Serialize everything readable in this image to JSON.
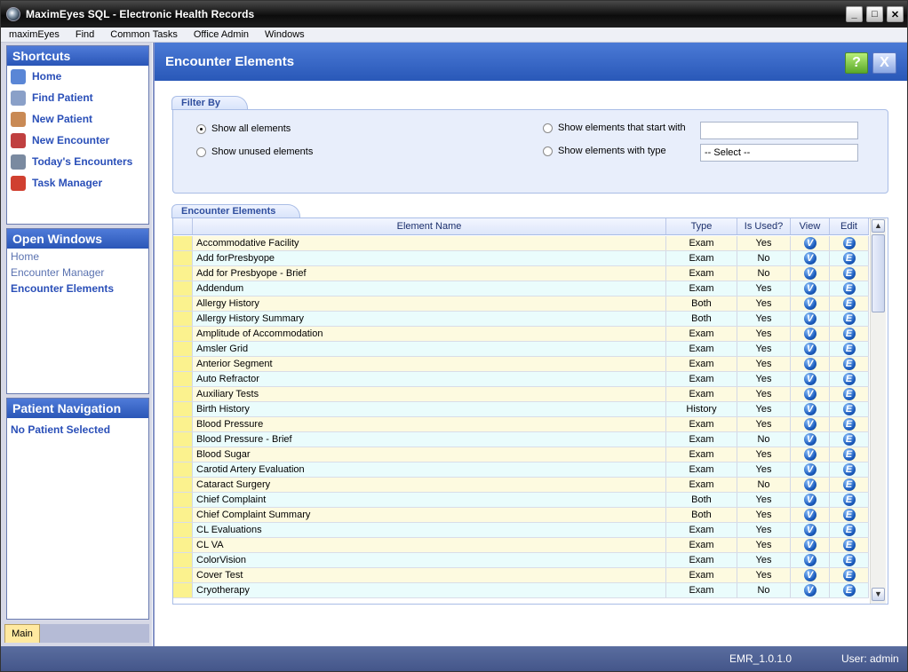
{
  "window": {
    "title": "MaximEyes SQL - Electronic Health Records",
    "min": "_",
    "max": "□",
    "close": "✕"
  },
  "menu": [
    "maximEyes",
    "Find",
    "Common Tasks",
    "Office Admin",
    "Windows"
  ],
  "sidebar": {
    "shortcuts_title": "Shortcuts",
    "shortcuts": [
      {
        "label": "Home",
        "icon": "home-icon",
        "color": "#5a86d6"
      },
      {
        "label": "Find Patient",
        "icon": "find-patient-icon",
        "color": "#8aa0c8"
      },
      {
        "label": "New Patient",
        "icon": "new-patient-icon",
        "color": "#c98a55"
      },
      {
        "label": "New Encounter",
        "icon": "new-encounter-icon",
        "color": "#c04040"
      },
      {
        "label": "Today's Encounters",
        "icon": "todays-encounters-icon",
        "color": "#7a8aa0"
      },
      {
        "label": "Task Manager",
        "icon": "task-manager-icon",
        "color": "#d04030"
      }
    ],
    "open_windows_title": "Open Windows",
    "open_windows": [
      {
        "label": "Home",
        "active": false
      },
      {
        "label": "Encounter Manager",
        "active": false
      },
      {
        "label": "Encounter Elements",
        "active": true
      }
    ],
    "patient_nav_title": "Patient Navigation",
    "patient_nav_text": "No Patient Selected",
    "main_tab": "Main"
  },
  "content": {
    "title": "Encounter Elements",
    "help_label": "?",
    "close_label": "X",
    "filter": {
      "tab": "Filter By",
      "show_all": "Show all elements",
      "show_unused": "Show unused elements",
      "start_with": "Show elements that start with",
      "with_type": "Show elements with type",
      "start_with_value": "",
      "type_value": "-- Select --",
      "selected": "show_all"
    },
    "grid": {
      "tab": "Encounter Elements",
      "columns": [
        "Element Name",
        "Type",
        "Is Used?",
        "View",
        "Edit"
      ],
      "view_glyph": "V",
      "edit_glyph": "E",
      "rows": [
        {
          "name": "Accommodative Facility",
          "type": "Exam",
          "used": "Yes"
        },
        {
          "name": "Add forPresbyope",
          "type": "Exam",
          "used": "No"
        },
        {
          "name": "Add for Presbyope - Brief",
          "type": "Exam",
          "used": "No"
        },
        {
          "name": "Addendum",
          "type": "Exam",
          "used": "Yes"
        },
        {
          "name": "Allergy History",
          "type": "Both",
          "used": "Yes"
        },
        {
          "name": "Allergy History Summary",
          "type": "Both",
          "used": "Yes"
        },
        {
          "name": "Amplitude of Accommodation",
          "type": "Exam",
          "used": "Yes"
        },
        {
          "name": "Amsler Grid",
          "type": "Exam",
          "used": "Yes"
        },
        {
          "name": "Anterior Segment",
          "type": "Exam",
          "used": "Yes"
        },
        {
          "name": "Auto Refractor",
          "type": "Exam",
          "used": "Yes"
        },
        {
          "name": "Auxiliary Tests",
          "type": "Exam",
          "used": "Yes"
        },
        {
          "name": "Birth History",
          "type": "History",
          "used": "Yes"
        },
        {
          "name": "Blood Pressure",
          "type": "Exam",
          "used": "Yes"
        },
        {
          "name": "Blood Pressure - Brief",
          "type": "Exam",
          "used": "No"
        },
        {
          "name": "Blood Sugar",
          "type": "Exam",
          "used": "Yes"
        },
        {
          "name": "Carotid Artery Evaluation",
          "type": "Exam",
          "used": "Yes"
        },
        {
          "name": "Cataract Surgery",
          "type": "Exam",
          "used": "No"
        },
        {
          "name": "Chief Complaint",
          "type": "Both",
          "used": "Yes"
        },
        {
          "name": "Chief Complaint Summary",
          "type": "Both",
          "used": "Yes"
        },
        {
          "name": "CL Evaluations",
          "type": "Exam",
          "used": "Yes"
        },
        {
          "name": "CL VA",
          "type": "Exam",
          "used": "Yes"
        },
        {
          "name": "ColorVision",
          "type": "Exam",
          "used": "Yes"
        },
        {
          "name": "Cover Test",
          "type": "Exam",
          "used": "Yes"
        },
        {
          "name": "Cryotherapy",
          "type": "Exam",
          "used": "No"
        }
      ]
    }
  },
  "status": {
    "version": "EMR_1.0.1.0",
    "user": "User: admin"
  }
}
